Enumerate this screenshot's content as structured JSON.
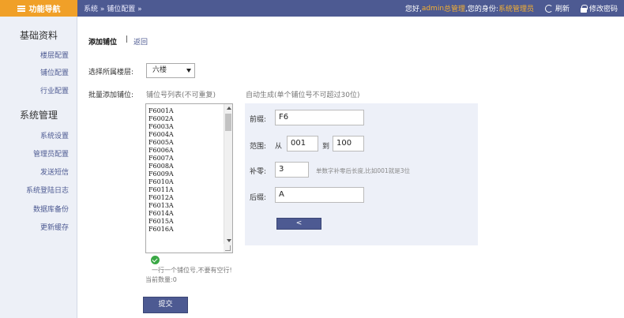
{
  "topbar": {
    "nav_label": "功能导航",
    "breadcrumb": "系统 » 铺位配置 »",
    "greeting_prefix": "您好,",
    "username": "admin",
    "role_name": "总管理",
    "identity_prefix": ",您的身份:",
    "identity": "系统管理员",
    "refresh_label": "刷新",
    "change_password_label": "修改密码"
  },
  "sidebar": {
    "groups": [
      {
        "title": "基础资料",
        "items": [
          "楼层配置",
          "铺位配置",
          "行业配置"
        ]
      },
      {
        "title": "系统管理",
        "items": [
          "系统设置",
          "管理员配置",
          "发送短信",
          "系统登陆日志",
          "数据库备份",
          "更新缓存"
        ]
      }
    ]
  },
  "main": {
    "tab_title": "添加铺位",
    "tab_separator": "|",
    "tab_back": "返回",
    "floor_label": "选择所属楼层:",
    "floor_selected": "六楼",
    "batch_label": "批量添加铺位:",
    "list_header": "铺位号列表(不可重复)",
    "auto_header": "自动生成(单个铺位号不可超过30位)",
    "list_items": [
      "F6001A",
      "F6002A",
      "F6003A",
      "F6004A",
      "F6005A",
      "F6006A",
      "F6007A",
      "F6008A",
      "F6009A",
      "F6010A",
      "F6011A",
      "F6012A",
      "F6013A",
      "F6014A",
      "F6015A",
      "F6016A"
    ],
    "hint": "一行一个铺位号,不要有空行!",
    "count_label": "当前数量:",
    "count_value": "0",
    "submit_label": "提交"
  },
  "generator": {
    "prefix_label": "前缀:",
    "prefix_value": "F6",
    "range_label": "范围:",
    "range_from_label": "从",
    "range_from": "001",
    "range_to_label": "到",
    "range_to": "100",
    "pad_label": "补零:",
    "pad_value": "3",
    "pad_note": "单数字补零后长度,比如001就是3位",
    "suffix_label": "后缀:",
    "suffix_value": "A",
    "generate_label": "<"
  },
  "colors": {
    "topbar": "#4d5a92",
    "nav_accent": "#f0a028",
    "highlight": "#f5b031",
    "sidebar_bg": "#edf0f7",
    "panel_bg": "#edf0f8",
    "success": "#3aa845"
  }
}
